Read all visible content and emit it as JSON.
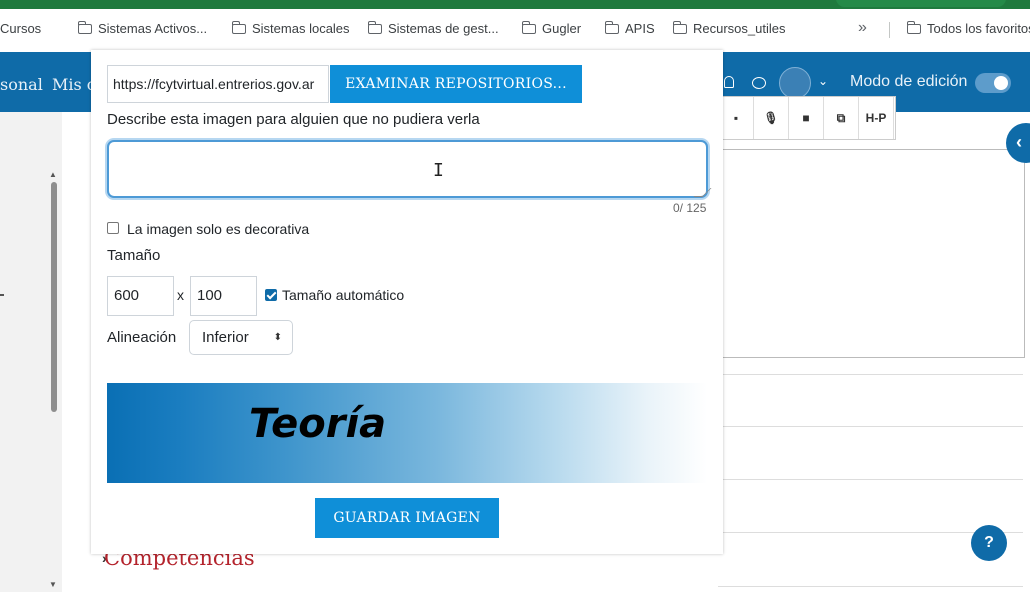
{
  "bookmarks": [
    {
      "label": "Cursos"
    },
    {
      "label": "Sistemas Activos..."
    },
    {
      "label": "Sistemas locales"
    },
    {
      "label": "Sistemas de gest..."
    },
    {
      "label": "Gugler"
    },
    {
      "label": "APIS"
    },
    {
      "label": "Recursos_utiles"
    }
  ],
  "bookmarks_more": "»",
  "bookmarks_all": "Todos los favoritos",
  "navbar": {
    "left_text_1": "sonal",
    "left_text_2": "Mis c",
    "edit_mode_label": "Modo de edición",
    "edit_mode_on": true
  },
  "toolbar": {
    "h5p_label": "H-P"
  },
  "page": {
    "section_title": "Competencias"
  },
  "help_label": "?",
  "modal": {
    "url_value": "https://fcytvirtual.entrerios.gov.ar",
    "browse_label": "EXAMINAR REPOSITORIOS...",
    "alt_label": "Describe esta imagen para alguien que no pudiera verla",
    "alt_value": "",
    "counter": "0/ 125",
    "decorative_label": "La imagen solo es decorativa",
    "size_label": "Tamaño",
    "width": "600",
    "height": "100",
    "times": "x",
    "auto_size_label": "Tamaño automático",
    "align_label": "Alineación",
    "align_value": "Inferior",
    "preview_text": "Teoría",
    "save_label": "GUARDAR IMAGEN"
  }
}
